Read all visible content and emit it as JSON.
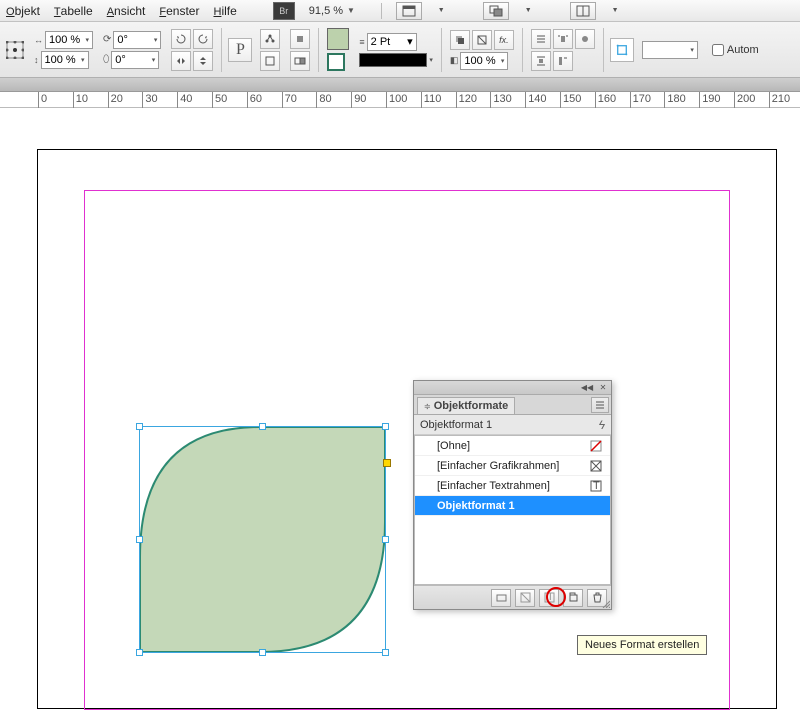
{
  "menu": {
    "items": [
      "Objekt",
      "Tabelle",
      "Ansicht",
      "Fenster",
      "Hilfe"
    ],
    "bridge_label": "Br",
    "zoom": "91,5 %"
  },
  "control": {
    "scale_x": "100 %",
    "scale_y": "100 %",
    "rotate": "0°",
    "shear": "0°",
    "stroke_weight": "2 Pt",
    "opacity": "100 %",
    "autom_label": "Autom"
  },
  "ruler": {
    "ticks": [
      0,
      10,
      20,
      30,
      40,
      50,
      60,
      70,
      80,
      90,
      100,
      110,
      120,
      130,
      140,
      150,
      160,
      170,
      180,
      190,
      200,
      210
    ]
  },
  "shape": {
    "fill": "#c4d8b8",
    "stroke": "#2c8a72"
  },
  "panel": {
    "tab_title": "Objektformate",
    "selected_name": "Objektformat 1",
    "items": [
      {
        "label": "[Ohne]",
        "icon": "none"
      },
      {
        "label": "[Einfacher Grafikrahmen]",
        "icon": "square"
      },
      {
        "label": "[Einfacher Textrahmen]",
        "icon": "text"
      },
      {
        "label": "Objektformat 1",
        "icon": "",
        "selected": true
      }
    ]
  },
  "tooltip": "Neues Format erstellen"
}
